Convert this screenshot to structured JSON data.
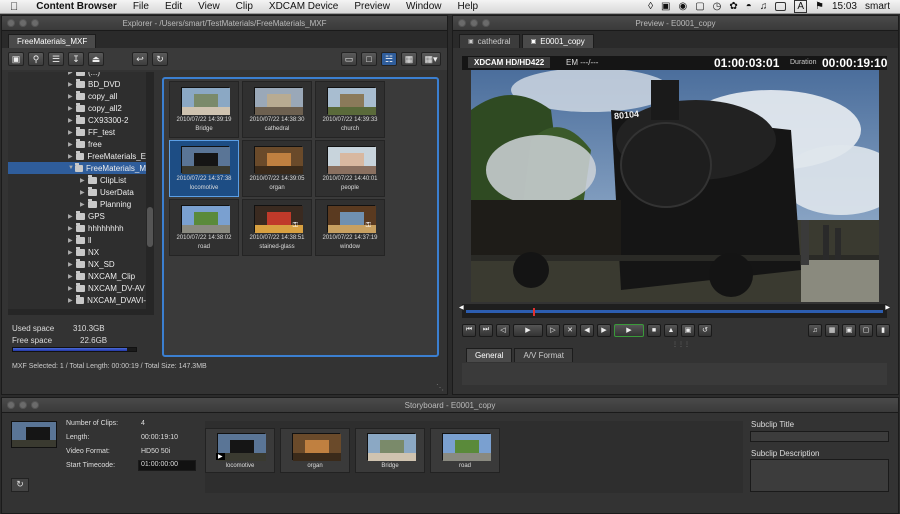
{
  "menubar": {
    "apple": "",
    "app_name": "Content Browser",
    "menus": [
      "File",
      "Edit",
      "View",
      "Clip",
      "XDCAM Device",
      "Preview",
      "Window",
      "Help"
    ],
    "time": "15:03",
    "user": "smart",
    "input_letter": "A"
  },
  "explorer": {
    "title": "Explorer - /Users/smart/TestMaterials/FreeMaterials_MXF",
    "tab": "FreeMaterials_MXF",
    "tree": [
      {
        "label": "(...)",
        "expanded": false
      },
      {
        "label": "BD_DVD",
        "expanded": false
      },
      {
        "label": "copy_all",
        "expanded": false
      },
      {
        "label": "copy_all2",
        "expanded": false
      },
      {
        "label": "CX93300-2",
        "expanded": false
      },
      {
        "label": "FF_test",
        "expanded": false
      },
      {
        "label": "free",
        "expanded": false
      },
      {
        "label": "FreeMaterials_E",
        "expanded": false
      },
      {
        "label": "FreeMaterials_M",
        "expanded": true,
        "selected": true
      },
      {
        "label": "ClipList",
        "child": true
      },
      {
        "label": "UserData",
        "child": true
      },
      {
        "label": "Planning",
        "child": true
      },
      {
        "label": "GPS",
        "expanded": false
      },
      {
        "label": "hhhhhhhh",
        "expanded": false
      },
      {
        "label": "ll",
        "expanded": false
      },
      {
        "label": "NX",
        "expanded": false
      },
      {
        "label": "NX_SD",
        "expanded": false
      },
      {
        "label": "NXCAM_Clip",
        "expanded": false
      },
      {
        "label": "NXCAM_DV-AV",
        "expanded": false
      },
      {
        "label": "NXCAM_DVAVI-",
        "expanded": false
      }
    ],
    "used_label": "Used space",
    "used_value": "310.3GB",
    "free_label": "Free space",
    "free_value": "22.6GB",
    "space_used_fraction": 0.93,
    "status": "MXF   Selected: 1 / Total Length: 00:00:19 / Total Size: 147.3MB",
    "clips": [
      {
        "date": "2010/07/22 14:39:19",
        "name": "Bridge",
        "selected": false,
        "locked": false
      },
      {
        "date": "2010/07/22 14:38:30",
        "name": "cathedral",
        "selected": false,
        "locked": false
      },
      {
        "date": "2010/07/22 14:39:33",
        "name": "church",
        "selected": false,
        "locked": false
      },
      {
        "date": "2010/07/22 14:37:38",
        "name": "locomotive",
        "selected": true,
        "locked": false
      },
      {
        "date": "2010/07/22 14:39:05",
        "name": "organ",
        "selected": false,
        "locked": false
      },
      {
        "date": "2010/07/22 14:40:01",
        "name": "people",
        "selected": false,
        "locked": false
      },
      {
        "date": "2010/07/22 14:38:02",
        "name": "road",
        "selected": false,
        "locked": false
      },
      {
        "date": "2010/07/22 14:38:51",
        "name": "stained-glass",
        "selected": false,
        "locked": true
      },
      {
        "date": "2010/07/22 14:37:19",
        "name": "window",
        "selected": false,
        "locked": true
      }
    ]
  },
  "preview": {
    "title": "Preview - E0001_copy",
    "tabs": [
      "cathedral",
      "E0001_copy"
    ],
    "format": "XDCAM HD/HD422",
    "em": "EM ---/---",
    "timecode": "01:00:03:01",
    "duration_label": "Duration",
    "duration": "00:00:19:10",
    "smokebox_number": "80104",
    "playhead_fraction": 0.16,
    "bottom_tabs": [
      "General",
      "A/V Format"
    ]
  },
  "storyboard": {
    "title": "Storyboard - E0001_copy",
    "fields": [
      {
        "label": "Number of Clips:",
        "value": "4"
      },
      {
        "label": "Length:",
        "value": "00:00:19:10"
      },
      {
        "label": "Video Format:",
        "value": "HD50 50i"
      },
      {
        "label": "Start Timecode:",
        "value": "01:00:00:00"
      }
    ],
    "clips": [
      "locomotive",
      "organ",
      "Bridge",
      "road"
    ],
    "subclip_title_label": "Subclip Title",
    "subclip_desc_label": "Subclip Description"
  },
  "colors": {
    "accent": "#3b7fd0",
    "selection": "#2f5d9b",
    "bg": "#333333"
  }
}
